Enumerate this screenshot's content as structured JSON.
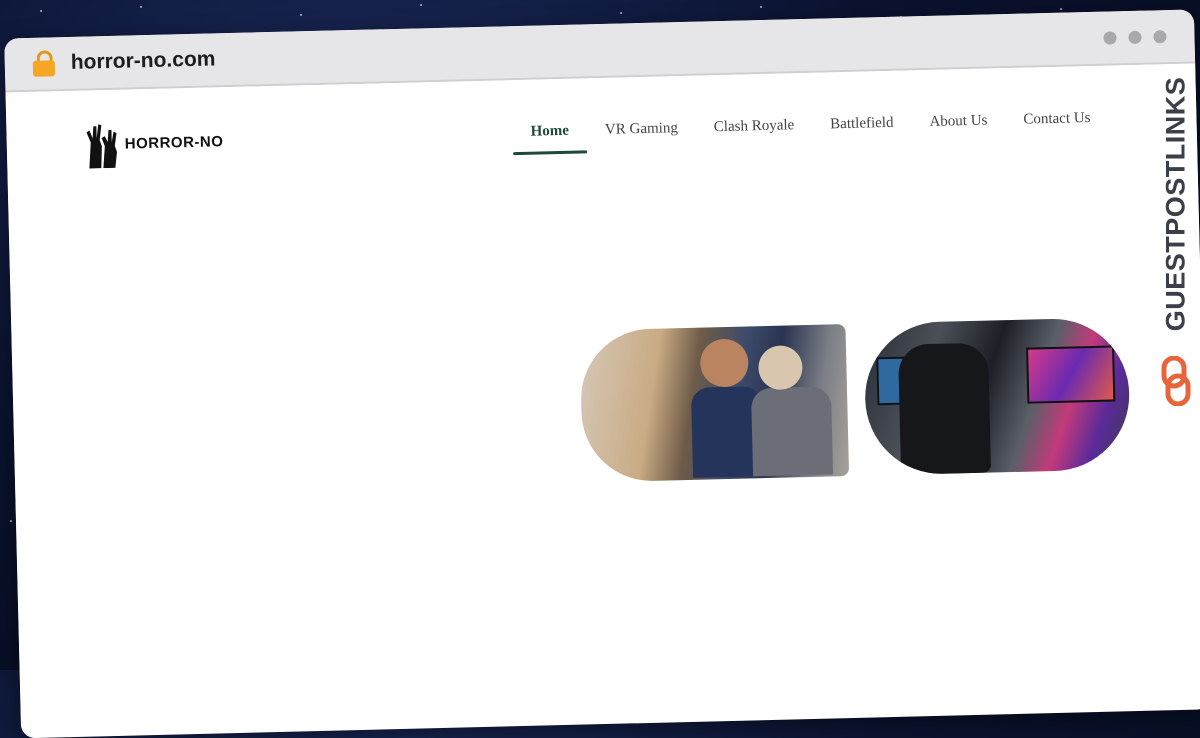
{
  "browser": {
    "url": "horror-no.com",
    "lock_icon": "lock-icon",
    "window_controls": [
      "dot",
      "dot",
      "dot"
    ]
  },
  "site": {
    "logo_text": "HORROR-NO",
    "logo_icon": "zombie-hands-icon",
    "nav": [
      {
        "label": "Home",
        "active": true
      },
      {
        "label": "VR Gaming",
        "active": false
      },
      {
        "label": "Clash Royale",
        "active": false
      },
      {
        "label": "Battlefield",
        "active": false
      },
      {
        "label": "About Us",
        "active": false
      },
      {
        "label": "Contact Us",
        "active": false
      }
    ],
    "accent_color": "#1e4a3a"
  },
  "images": [
    {
      "name": "hero-photo-family-gaming"
    },
    {
      "name": "hero-photo-gaming-room"
    }
  ],
  "watermark": {
    "text": "GUESTPOSTLINKS",
    "icon": "chain-link-icon",
    "color": "#e8643a"
  }
}
